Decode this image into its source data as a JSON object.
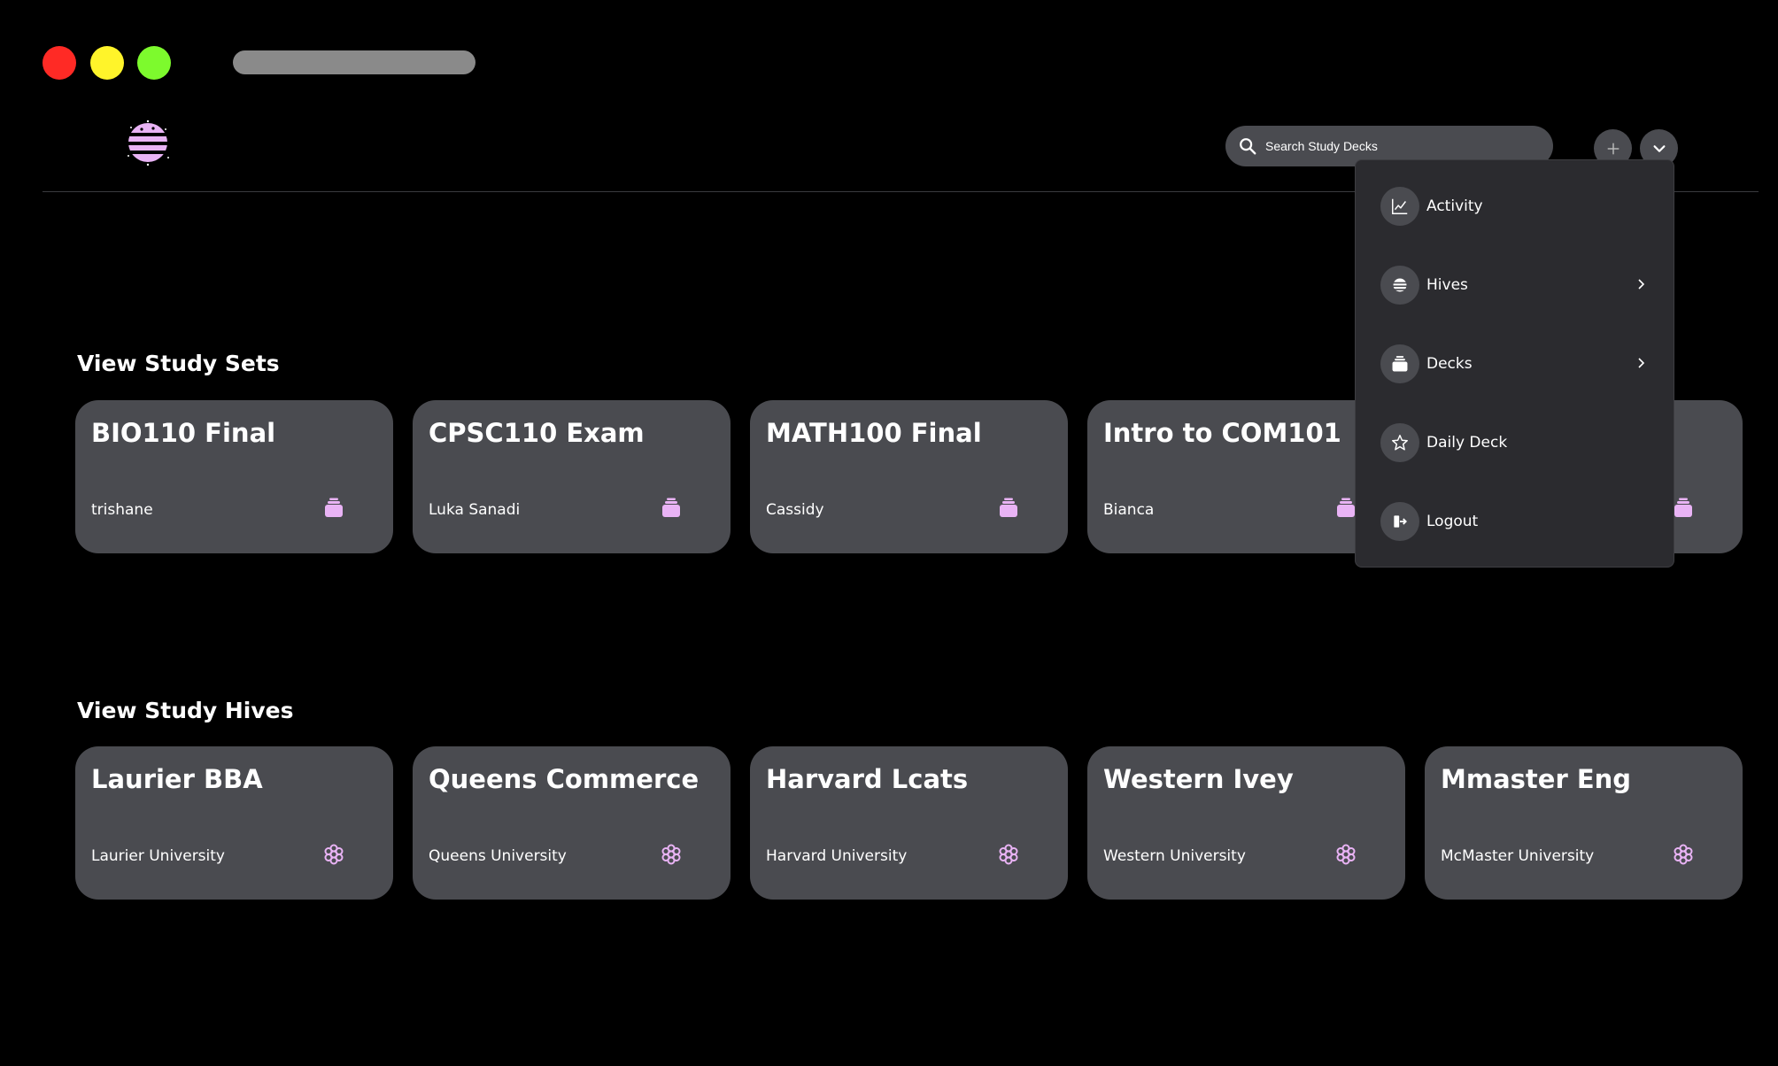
{
  "colors": {
    "background": "#000000",
    "card": "#4a4b50",
    "accent": "#e9b3f5",
    "menu": "#2b2b2f"
  },
  "header": {
    "search_placeholder": "Search Study Decks",
    "logo_icon": "hive-logo-icon",
    "add_icon": "plus-icon",
    "menu_icon": "chevron-down-icon"
  },
  "study_sets": {
    "title": "View Study Sets",
    "items": [
      {
        "title": "BIO110 Final",
        "author": "trishane",
        "icon": "deck-icon"
      },
      {
        "title": "CPSC110 Exam",
        "author": "Luka Sanadi",
        "icon": "deck-icon"
      },
      {
        "title": "MATH100 Final",
        "author": "Cassidy",
        "icon": "deck-icon"
      },
      {
        "title": "Intro to COM101",
        "author": "Bianca",
        "icon": "deck-icon"
      },
      {
        "title": "",
        "author": "",
        "icon": "deck-icon"
      }
    ]
  },
  "study_hives": {
    "title": "View Study Hives",
    "items": [
      {
        "title": "Laurier BBA",
        "school": "Laurier University",
        "icon": "hive-icon"
      },
      {
        "title": "Queens Commerce",
        "school": "Queens University",
        "icon": "hive-icon"
      },
      {
        "title": "Harvard Lcats",
        "school": "Harvard University",
        "icon": "hive-icon"
      },
      {
        "title": "Western Ivey",
        "school": "Western University",
        "icon": "hive-icon"
      },
      {
        "title": "Mmaster Eng",
        "school": "McMaster University",
        "icon": "hive-icon"
      }
    ]
  },
  "menu": {
    "items": [
      {
        "label": "Activity",
        "icon": "chart-line-icon"
      },
      {
        "label": "Hives",
        "icon": "hive-icon",
        "submenu": true
      },
      {
        "label": "Decks",
        "icon": "deck-icon",
        "submenu": true
      },
      {
        "label": "Daily Deck",
        "icon": "star-icon"
      },
      {
        "label": "Logout",
        "icon": "logout-icon"
      }
    ]
  }
}
